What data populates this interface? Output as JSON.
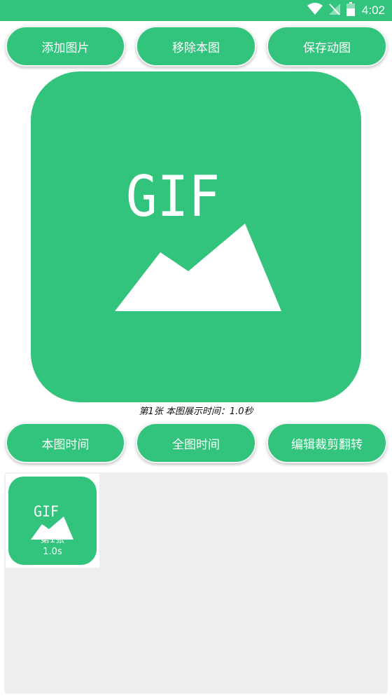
{
  "status": {
    "time": "4:02",
    "icons": [
      "wifi-icon",
      "no-signal-icon",
      "battery-icon"
    ]
  },
  "top_buttons": [
    {
      "label": "添加图片"
    },
    {
      "label": "移除本图"
    },
    {
      "label": "保存动图"
    }
  ],
  "preview": {
    "image_text": "GIF",
    "icon": "gif-image-icon"
  },
  "caption": "第1张  本图展示时间：1.0秒",
  "bottom_buttons": [
    {
      "label": "本图时间"
    },
    {
      "label": "全图时间"
    },
    {
      "label": "编辑裁剪翻转"
    }
  ],
  "thumbnails": [
    {
      "image_text": "GIF",
      "index_label": "第1张",
      "duration": "1.0s"
    }
  ],
  "colors": {
    "accent": "#32c47c",
    "panel": "#eeeeee"
  }
}
